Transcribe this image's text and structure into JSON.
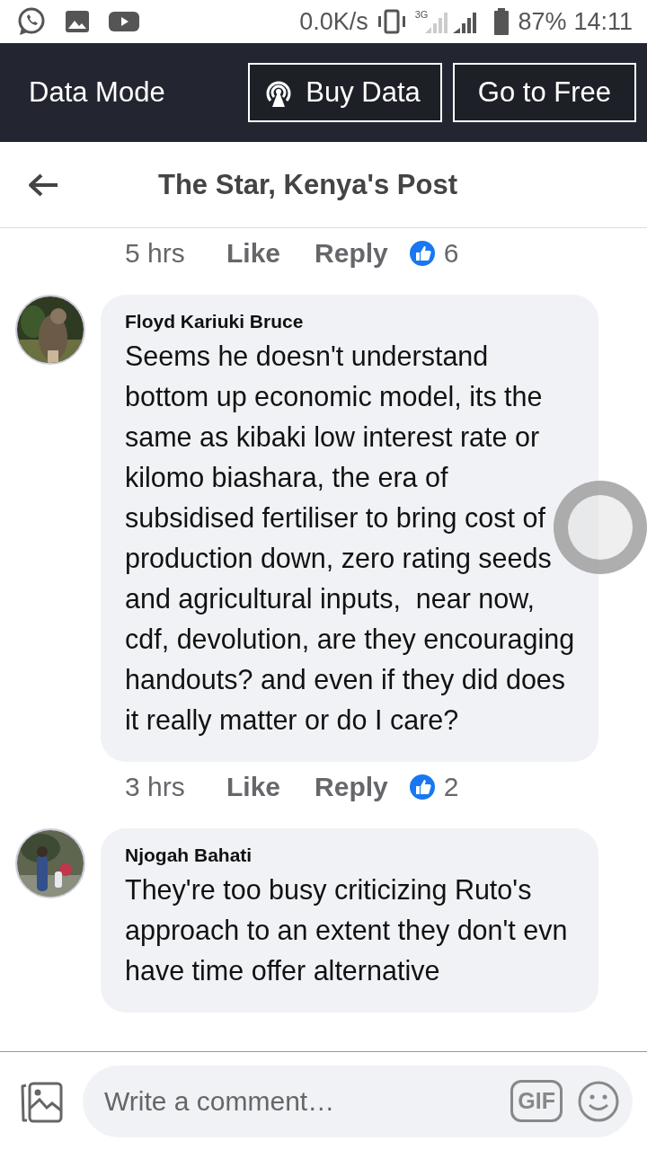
{
  "status_bar": {
    "speed": "0.0K/s",
    "network": "3G",
    "battery": "87%",
    "time": "14:11"
  },
  "data_mode_bar": {
    "label": "Data Mode",
    "buttons": [
      {
        "kind": "buy",
        "label": "Buy Data"
      },
      {
        "kind": "plain",
        "label": "Go to Free"
      }
    ]
  },
  "header": {
    "title": "The Star, Kenya's Post"
  },
  "top_meta": {
    "time": "5 hrs",
    "like": "Like",
    "reply": "Reply",
    "reactions": "6"
  },
  "comments": [
    {
      "author": "Floyd Kariuki Bruce",
      "text": "Seems he doesn't understand bottom up economic model, its the same as kibaki low interest rate or kilomo biashara, the era of subsidised fertiliser to bring cost of production down, zero rating seeds and agricultural inputs,  near now, cdf, devolution, are they encouraging handouts? and even if they did does it really matter or do I care?",
      "meta": {
        "time": "3 hrs",
        "like": "Like",
        "reply": "Reply",
        "reactions": "2"
      }
    },
    {
      "author": "Njogah Bahati",
      "text": "They're too busy criticizing Ruto's approach to an extent they don't evn have time offer alternative"
    }
  ],
  "composer": {
    "placeholder": "Write a comment…",
    "gif": "GIF"
  }
}
